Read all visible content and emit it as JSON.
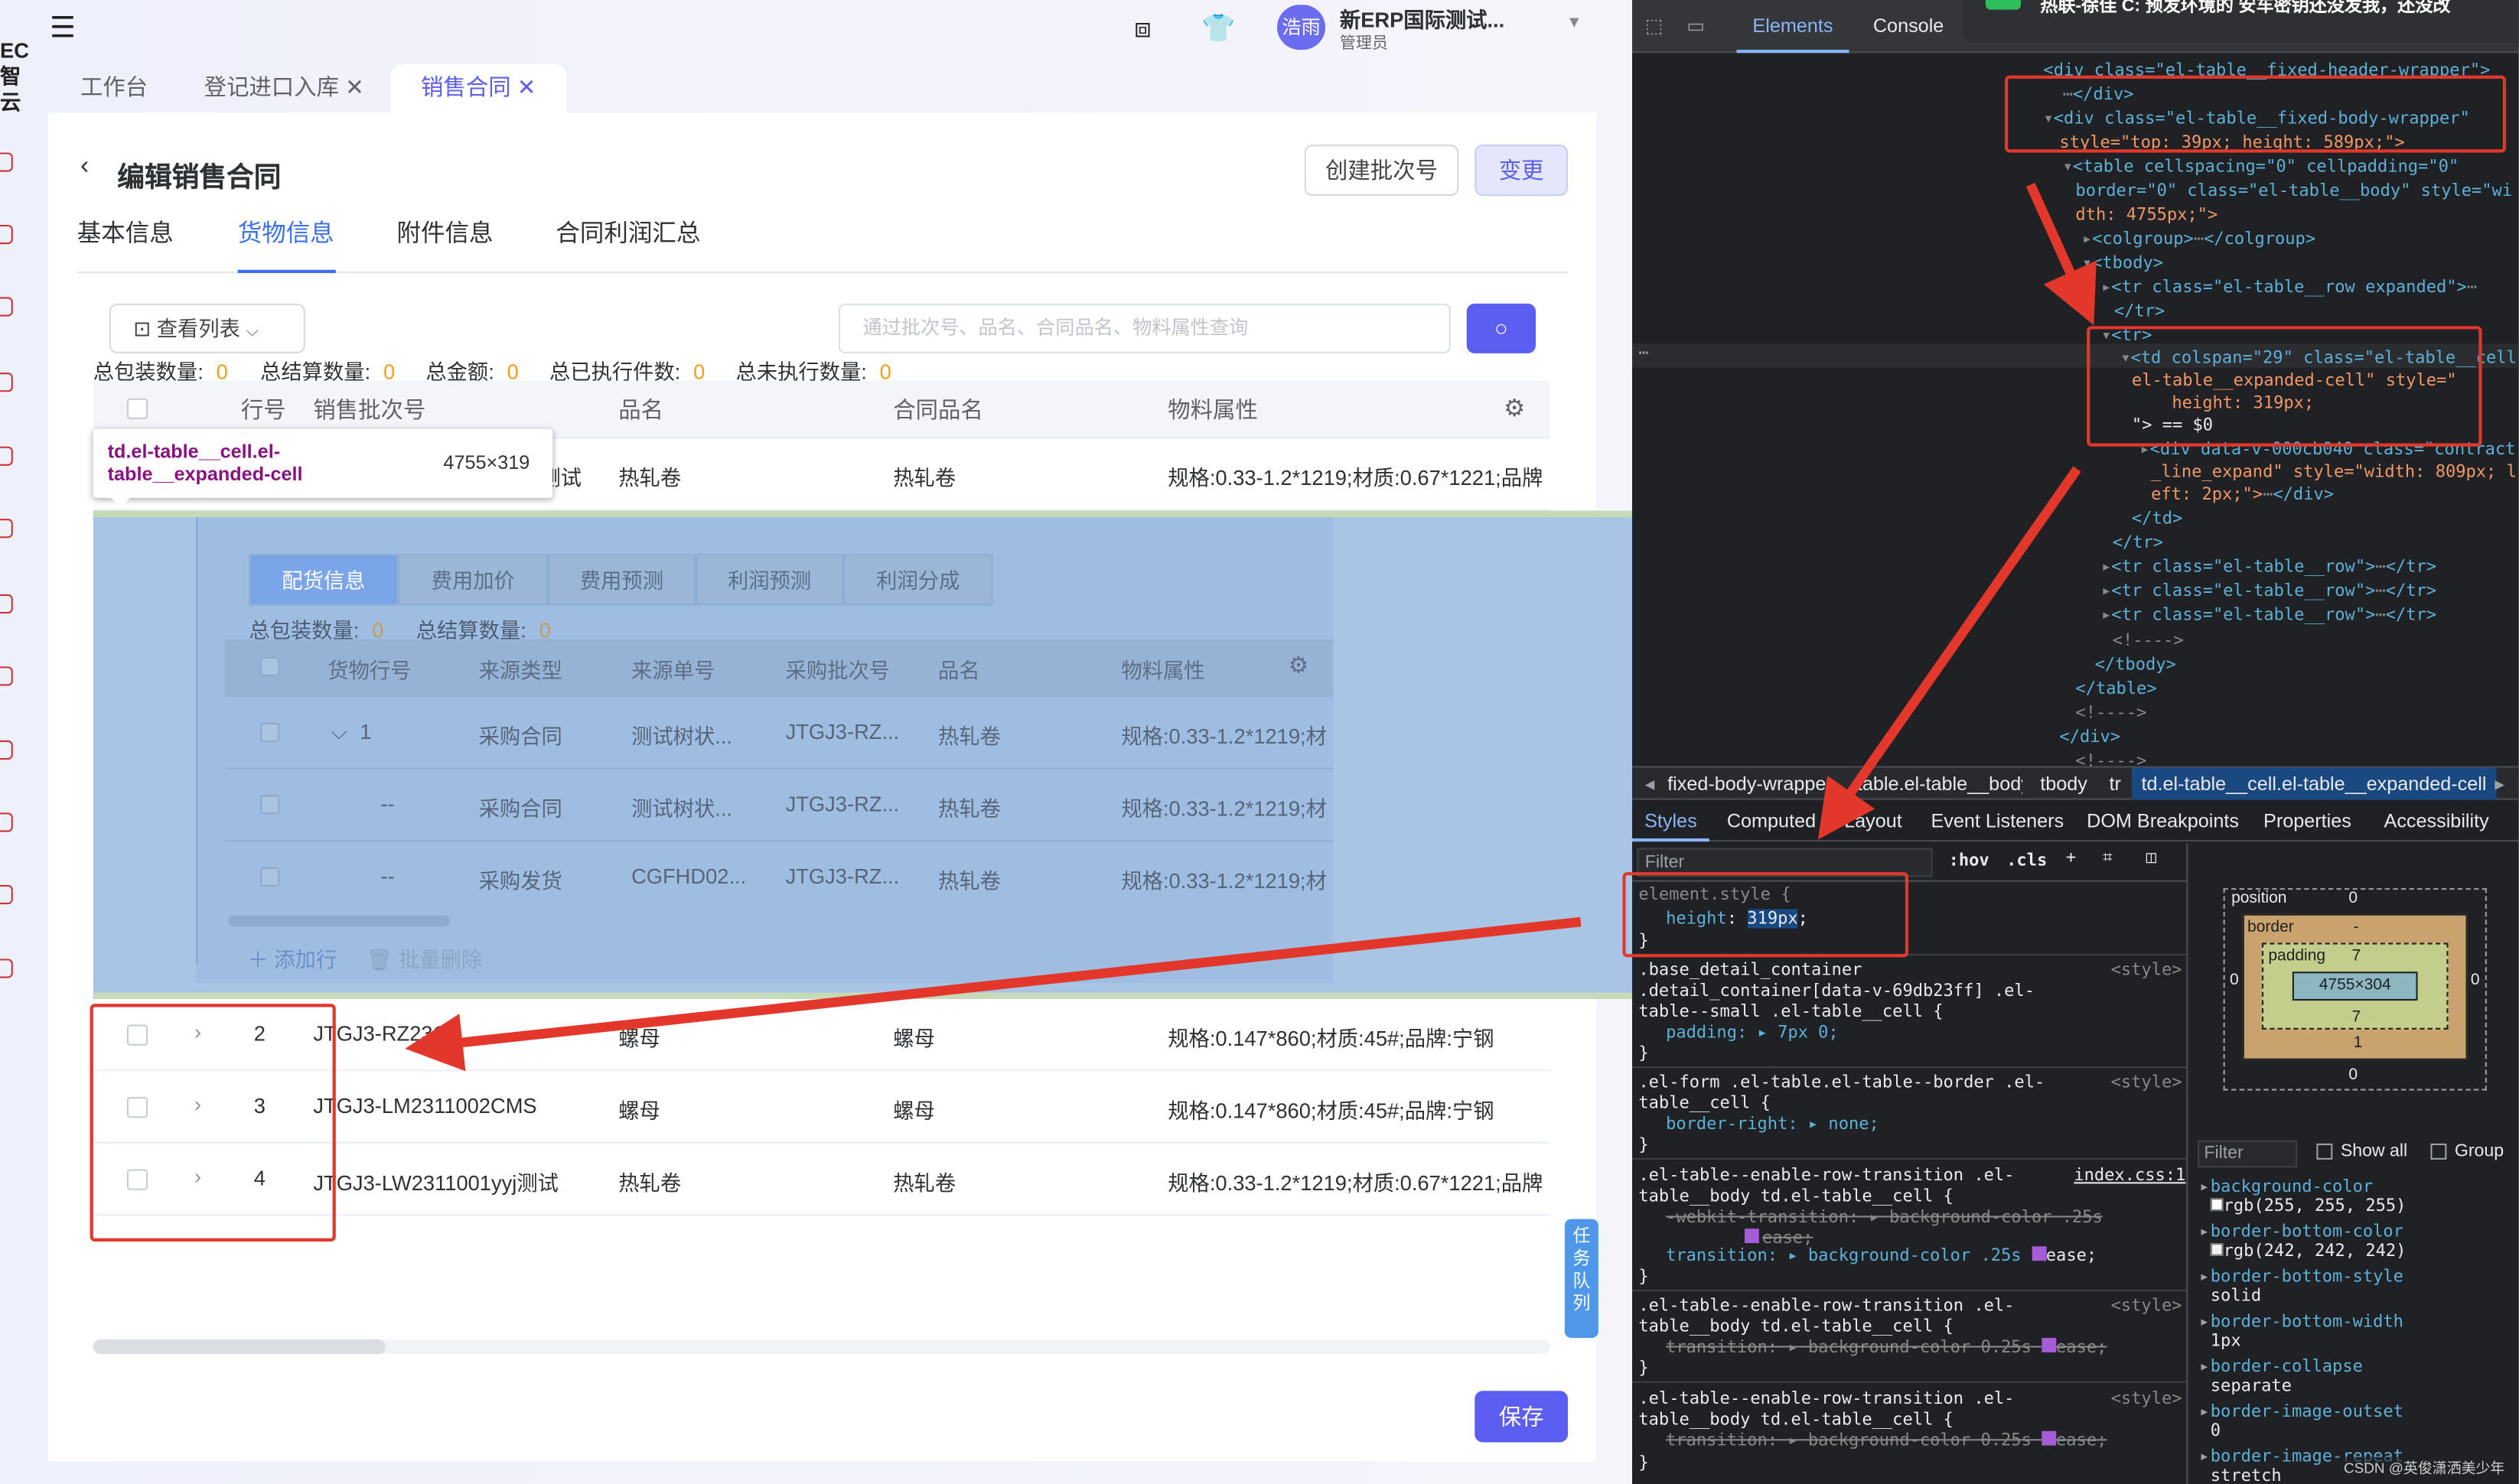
{
  "app": {
    "logo_lines": [
      "EC",
      "智云"
    ],
    "user_avatar_text": "浩雨",
    "user_name": "新ERP国际测试...",
    "user_role": "管理员",
    "tabs": [
      {
        "label": "工作台",
        "closable": false
      },
      {
        "label": "登记进口入库",
        "closable": true
      },
      {
        "label": "销售合同",
        "closable": true,
        "active": true
      }
    ],
    "page_title": "编辑销售合同",
    "buttons": {
      "create_batch": "创建批次号",
      "change": "变更",
      "save": "保存"
    },
    "sub_tabs": [
      "基本信息",
      "货物信息",
      "附件信息",
      "合同利润汇总"
    ],
    "active_sub_tab": "货物信息",
    "view_list_button": "查看列表",
    "search_placeholder": "通过批次号、品名、合同品名、物料属性查询",
    "summary": [
      {
        "label": "总包装数量:",
        "value": "0"
      },
      {
        "label": "总结算数量:",
        "value": "0"
      },
      {
        "label": "总金额:",
        "value": "0"
      },
      {
        "label": "总已执行件数:",
        "value": "0"
      },
      {
        "label": "总未执行数量:",
        "value": "0"
      }
    ],
    "table": {
      "headers": [
        "行号",
        "销售批次号",
        "品名",
        "合同品名",
        "物料属性"
      ],
      "first_row": {
        "batch": "测试",
        "name": "热轧卷",
        "contract_name": "热轧卷",
        "attr": "规格:0.33-1.2*1219;材质:0.67*1221;品牌"
      },
      "rows": [
        {
          "no": "2",
          "batch": "JTGJ3-RZ2311",
          "name": "螺母",
          "contract_name": "螺母",
          "attr": "规格:0.147*860;材质:45#;品牌:宁钢"
        },
        {
          "no": "3",
          "batch": "JTGJ3-LM2311002CMS",
          "name": "螺母",
          "contract_name": "螺母",
          "attr": "规格:0.147*860;材质:45#;品牌:宁钢"
        },
        {
          "no": "4",
          "batch": "JTGJ3-LW2311001yyj测试",
          "name": "热轧卷",
          "contract_name": "热轧卷",
          "attr": "规格:0.33-1.2*1219;材质:0.67*1221;品牌"
        }
      ]
    },
    "tooltip": {
      "selector": "td.el-table__cell.el-table__expanded-cell",
      "size": "4755×319"
    },
    "expanded": {
      "tabs": [
        "配货信息",
        "费用加价",
        "费用预测",
        "利润预测",
        "利润分成"
      ],
      "summary": [
        {
          "label": "总包装数量:",
          "value": "0"
        },
        {
          "label": "总结算数量:",
          "value": "0"
        }
      ],
      "headers": [
        "货物行号",
        "来源类型",
        "来源单号",
        "采购批次号",
        "品名",
        "物料属性"
      ],
      "rows": [
        {
          "no": "1",
          "type": "采购合同",
          "doc": "测试树状...",
          "batch": "JTGJ3-RZ...",
          "name": "热轧卷",
          "attr": "规格:0.33-1.2*1219;材"
        },
        {
          "no": "--",
          "type": "采购合同",
          "doc": "测试树状...",
          "batch": "JTGJ3-RZ...",
          "name": "热轧卷",
          "attr": "规格:0.33-1.2*1219;材"
        },
        {
          "no": "--",
          "type": "采购发货",
          "doc": "CGFHD02...",
          "batch": "JTGJ3-RZ...",
          "name": "热轧卷",
          "attr": "规格:0.33-1.2*1219;材"
        }
      ],
      "add_row": "添加行",
      "batch_delete": "批量删除"
    },
    "task_queue_chars": [
      "任",
      "务",
      "队",
      "列"
    ]
  },
  "devtools": {
    "tabs": [
      "Elements",
      "Console"
    ],
    "active_tab": "Elements",
    "notification": "热联-徐佳 C: 预发环境的 安车密钥还没发我，还没改",
    "dom_lines": [
      "<div class=\"el-table__fixed-header-wrapper\">",
      "</div>",
      "<div class=\"el-table__fixed-body-wrapper\"",
      "style=\"top: 39px; height: 589px;\">",
      "<table cellspacing=\"0\" cellpadding=\"0\"",
      "border=\"0\" class=\"el-table__body\" style=\"wi",
      "dth: 4755px;\">",
      "<colgroup>",
      "</colgroup>",
      "<tbody>",
      "<tr class=\"el-table__row expanded\">",
      "</tr>",
      "<tr>",
      "<td colspan=\"29\" class=\"el-table__cell",
      "el-table__expanded-cell\" style=\"",
      "height: 319px;",
      "\"> == $0",
      "<div data-v-000cb040 class=\"contract",
      "_line_expand\" style=\"width: 809px; l",
      "eft: 2px;\">",
      "</div>",
      "</td>",
      "</tr>",
      "<tr class=\"el-table__row\">",
      "</tr>",
      "<tr class=\"el-table__row\">",
      "</tr>",
      "<tr class=\"el-table__row\">",
      "</tr>",
      "<!---->",
      "</tbody>",
      "</table>",
      "<!---->",
      "</div>",
      "<!---->"
    ],
    "breadcrumbs": [
      "fixed-body-wrapper",
      "table.el-table__body",
      "tbody",
      "tr",
      "td.el-table__cell.el-table__expanded-cell"
    ],
    "style_tabs": [
      "Styles",
      "Computed",
      "Layout",
      "Event Listeners",
      "DOM Breakpoints",
      "Properties",
      "Accessibility"
    ],
    "filter_placeholder": "Filter",
    "filter_tools": [
      ":hov",
      ".cls"
    ],
    "rules": {
      "element_style": "element.style {",
      "height_prop": "height",
      "height_val": "319px",
      "r1_sel": [
        ".base_detail_container",
        ".detail_container[data-v-69db23ff] .el-",
        "table--small .el-table__cell {"
      ],
      "r1_decl": "padding: ▸ 7px 0;",
      "r2_sel": [
        ".el-form .el-table.el-table--border .el-",
        "table__cell {"
      ],
      "r2_decl": "border-right: ▸ none;",
      "r3_sel": [
        ".el-table--enable-row-transition .el-",
        "table__body td.el-table__cell {"
      ],
      "r3_decl1": "-webkit-transition: ▸ background-color .25s",
      "r3_decl1b": "ease;",
      "r3_decl2": "transition: ▸ background-color .25s",
      "r3_decl2b": "ease;",
      "r4_sel": [
        ".el-table--enable-row-transition .el-",
        "table__body td.el-table__cell {"
      ],
      "r4_decl": "transition: ▸ background-color 0.25s",
      "r4_declb": "ease;",
      "r5_sel": [
        ".el-table--enable-row-transition .el-",
        "table__body td.el-table__cell {"
      ],
      "r5_decl": "transition: ▸ background-color 0.25s",
      "r5_declb": "ease;",
      "source_style": "<style>",
      "source_index": "index.css:1",
      "brace": "}"
    },
    "box_model": {
      "position_label": "position",
      "position_val": "0",
      "border_label": "border",
      "border_val": "-",
      "padding_label": "padding",
      "padding_top": "7",
      "padding_bottom": "7",
      "content": "4755×304",
      "side_zero": "0",
      "bottom_border": "1",
      "outer_bottom": "0",
      "dash": "-"
    },
    "computed_filter": "Filter",
    "show_all": "Show all",
    "group": "Group",
    "computed": [
      {
        "name": "background-color",
        "value": "rgb(255, 255, 255)",
        "swatch": "#ffffff"
      },
      {
        "name": "border-bottom-color",
        "value": "rgb(242, 242, 242)",
        "swatch": "#f2f2f2"
      },
      {
        "name": "border-bottom-style",
        "value": "solid"
      },
      {
        "name": "border-bottom-width",
        "value": "1px"
      },
      {
        "name": "border-collapse",
        "value": "separate"
      },
      {
        "name": "border-image-outset",
        "value": "0"
      },
      {
        "name": "border-image-repeat",
        "value": "stretch"
      }
    ],
    "watermark": "CSDN @英俊潇洒美少年"
  }
}
